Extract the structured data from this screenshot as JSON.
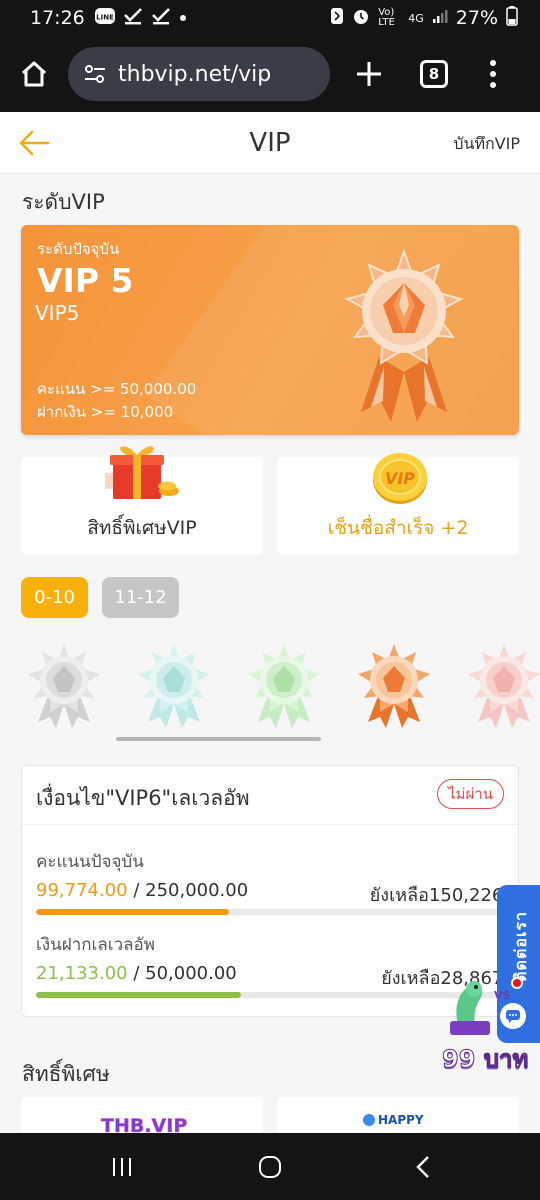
{
  "status_bar": {
    "time": "17:26",
    "icons_left": [
      "line-icon",
      "check-icon",
      "check-icon",
      "dot-icon"
    ],
    "network": "4G",
    "volte": "Vo) LTE",
    "battery_pct": "27%"
  },
  "browser": {
    "url": "thbvip.net/vip",
    "tab_count": "8"
  },
  "header": {
    "title": "VIP",
    "record_link": "บันทึกVIP"
  },
  "vip_section": {
    "title": "ระดับVIP",
    "card": {
      "current_label": "ระดับปัจจุบัน",
      "level_big": "VIP 5",
      "level_sub": "VIP5",
      "points_req": "คะแนน >= 50,000.00",
      "deposit_req": "ฝากเงิน >= 10,000",
      "accent": "#f5933a"
    }
  },
  "tiles": {
    "privilege_label": "สิทธิ์พิเศษVIP",
    "checkin_label": "เช็นชื่อสำเร็จ +2",
    "coin_text": "VIP"
  },
  "range_tabs": {
    "active": "0-10",
    "inactive": "11-12"
  },
  "condition": {
    "title": "เงื่อนไข\"VIP6\"เลเวลอัพ",
    "badge": "ไม่ผ่าน",
    "points": {
      "label": "คะแนนปัจจุบัน",
      "current": "99,774.00",
      "target": " / 250,000.00",
      "remaining": "ยังเหลือ150,226.00",
      "progress": 0.399
    },
    "deposit": {
      "label": "เงินฝากเลเวลอัพ",
      "current": "21,133.00",
      "target": " / 50,000.00",
      "remaining": "ยังเหลือ28,867.00",
      "progress": 0.4227
    }
  },
  "floating": {
    "tab_text": "ติดต่อเรา",
    "promo_text": "99 บาท"
  },
  "privileges_section": {
    "title": "สิทธิ์พิเศษ",
    "logo_left": "THB.VIP",
    "logo_right": "HAPPY"
  }
}
